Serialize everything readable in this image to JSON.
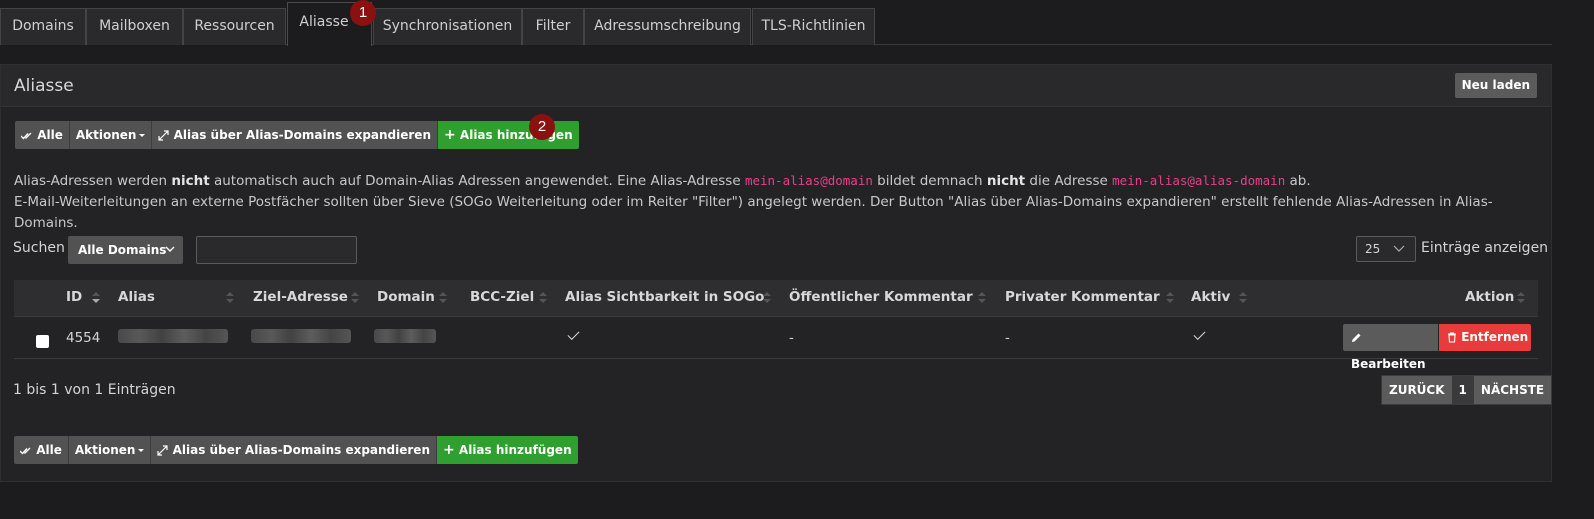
{
  "tabs": [
    {
      "label": "Domains"
    },
    {
      "label": "Mailboxen"
    },
    {
      "label": "Ressourcen"
    },
    {
      "label": "Aliasse",
      "active": true,
      "dropdown": true
    },
    {
      "label": "Synchronisationen"
    },
    {
      "label": "Filter"
    },
    {
      "label": "Adressumschreibung"
    },
    {
      "label": "TLS-Richtlinien"
    }
  ],
  "badges": {
    "one": "1",
    "two": "2"
  },
  "panel": {
    "title": "Aliasse",
    "reload_label": "Neu laden"
  },
  "toolbar": {
    "all_label": "Alle",
    "actions_label": "Aktionen",
    "expand_label": "Alias über Alias-Domains expandieren",
    "add_label": "Alias hinzufügen"
  },
  "info": {
    "line1_a": "Alias-Adressen werden ",
    "line1_b": "nicht",
    "line1_c": " automatisch auch auf Domain-Alias Adressen angewendet. Eine Alias-Adresse ",
    "line1_code1": "mein-alias@domain",
    "line1_d": " bildet demnach ",
    "line1_e": "nicht",
    "line1_f": " die Adresse ",
    "line1_code2": "mein-alias@alias-domain",
    "line1_g": " ab.",
    "line2": "E-Mail-Weiterleitungen an externe Postfächer sollten über Sieve (SOGo Weiterleitung oder im Reiter \"Filter\") angelegt werden. Der Button \"Alias über Alias-Domains expandieren\" erstellt fehlende Alias-Adressen in Alias-Domains."
  },
  "search": {
    "label": "Suchen",
    "domain_filter": "Alle Domains",
    "value": ""
  },
  "length": {
    "value": "25",
    "label": "Einträge anzeigen"
  },
  "table": {
    "headers": {
      "id": "ID",
      "alias": "Alias",
      "target": "Ziel-Adresse",
      "domain": "Domain",
      "bcc": "BCC-Ziel",
      "sogo": "Alias Sichtbarkeit in SOGo",
      "public": "Öffentlicher Kommentar",
      "private": "Privater Kommentar",
      "active": "Aktiv",
      "action": "Aktion"
    },
    "rows": [
      {
        "id": "4554",
        "public_comment": "-",
        "private_comment": "-",
        "edit_label": "Bearbeiten",
        "delete_label": "Entfernen"
      }
    ]
  },
  "footer": {
    "info": "1 bis 1 von 1 Einträgen",
    "prev": "ZURÜCK",
    "page": "1",
    "next": "NÄCHSTE"
  },
  "colors": {
    "green": "#2fa02f",
    "red": "#e83b3b",
    "badge": "#8b1010",
    "code": "#e83e8c"
  }
}
